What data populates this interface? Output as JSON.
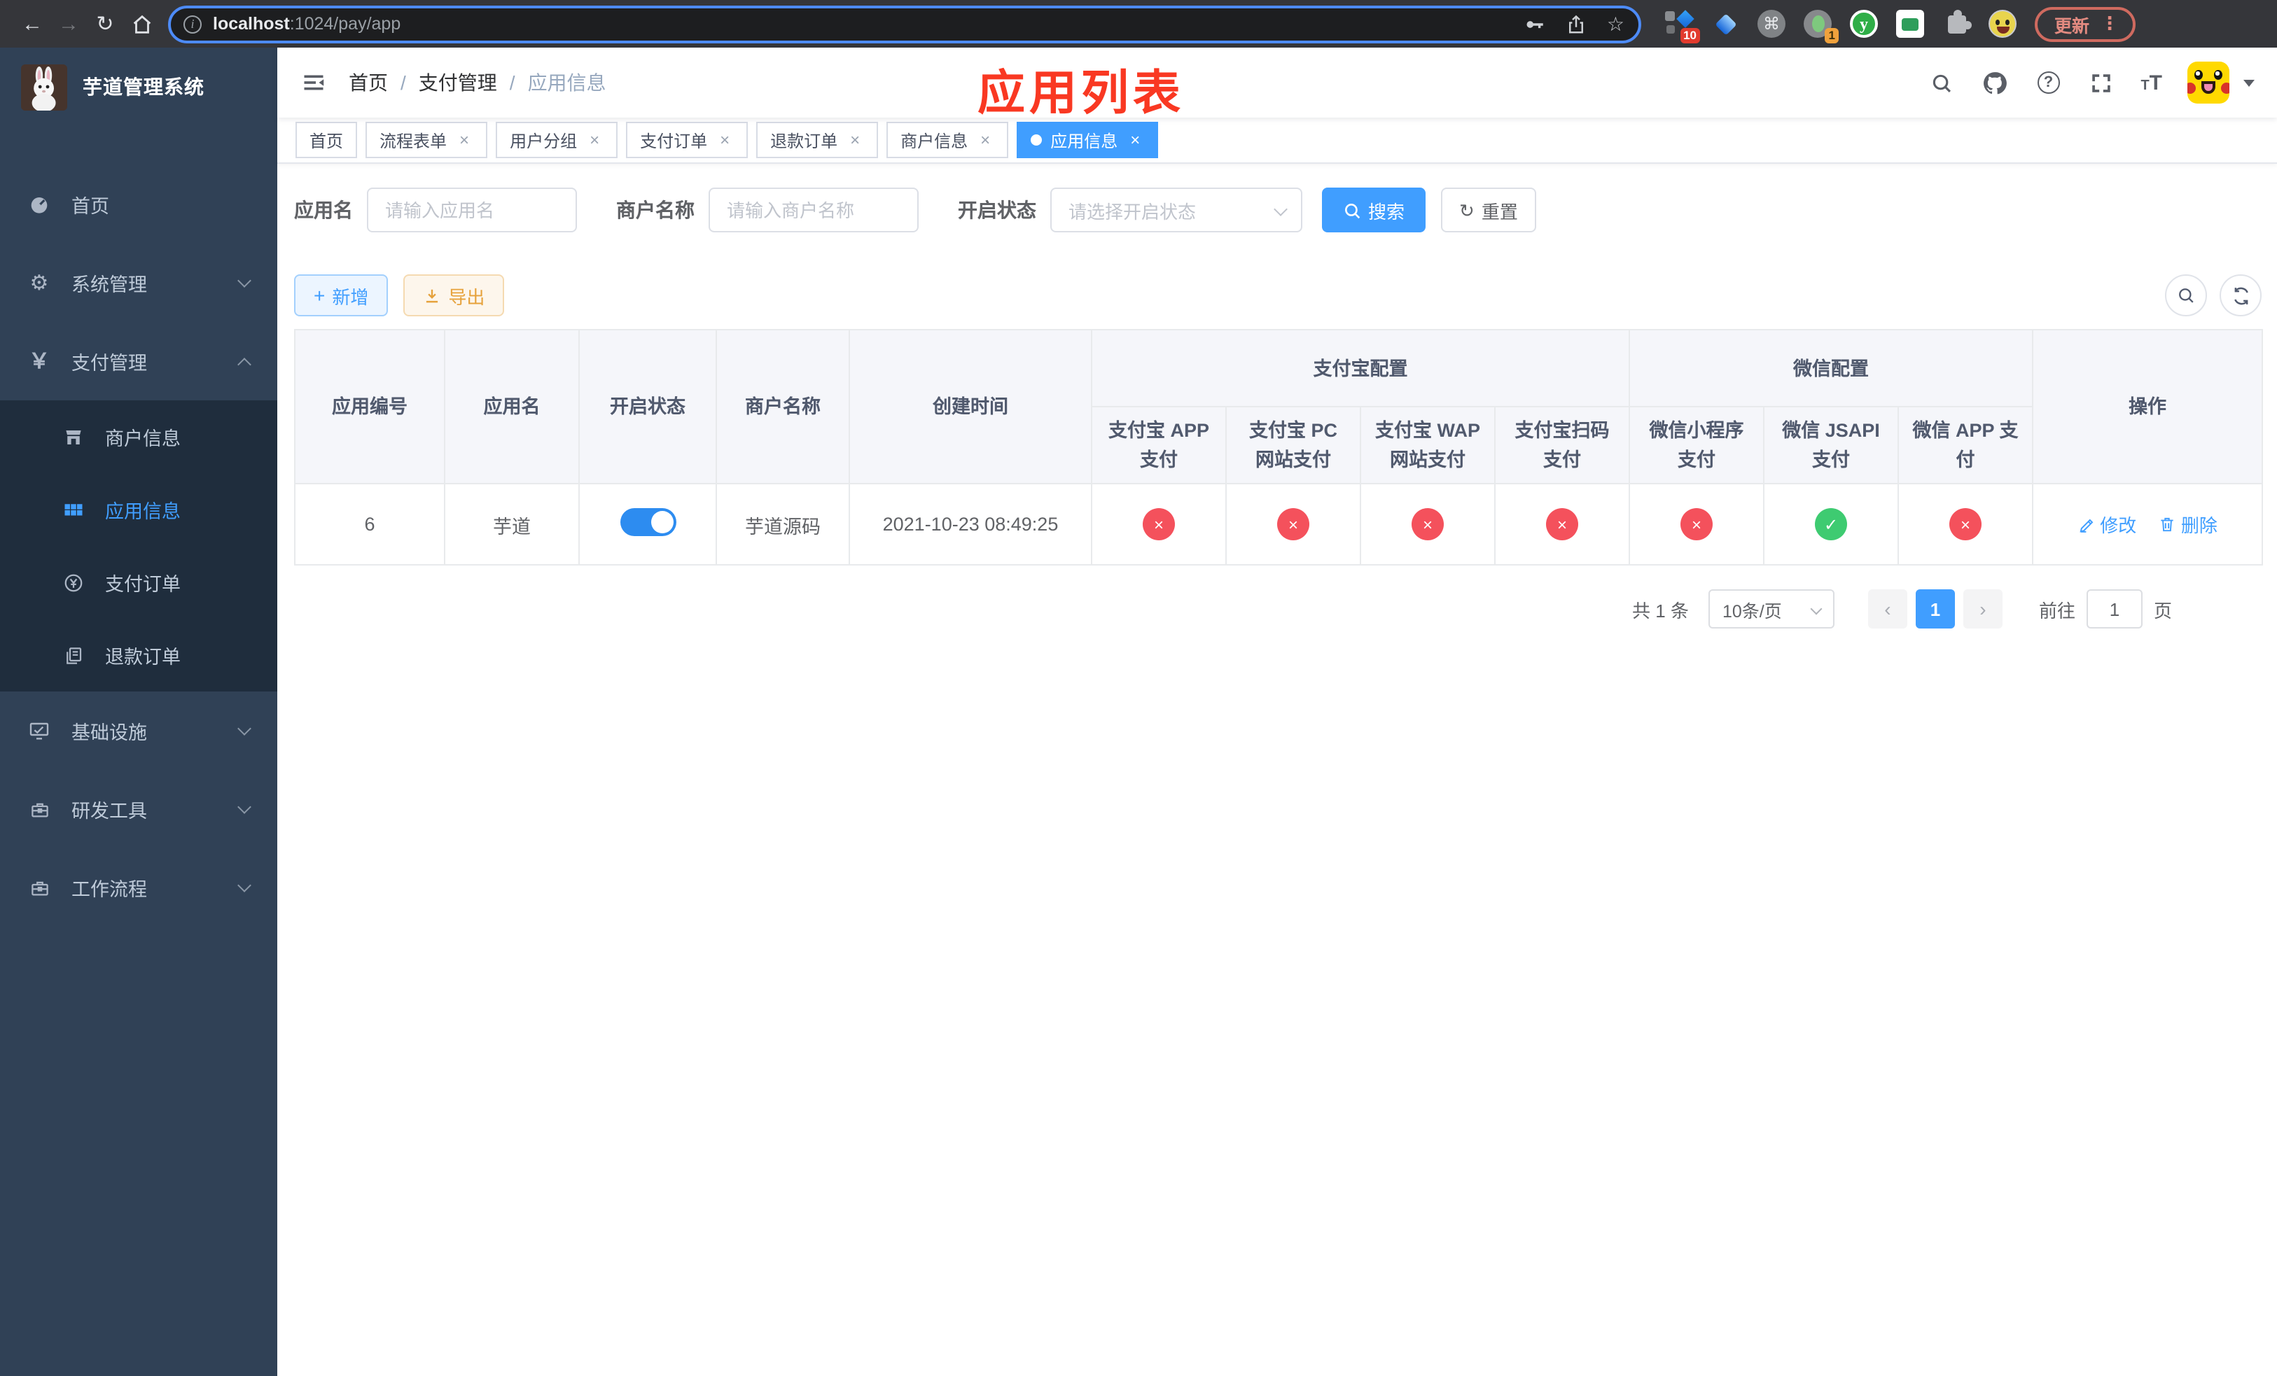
{
  "glyphs": {
    "back": "←",
    "forward": "→",
    "reload": "↻",
    "star": "☆",
    "info": "i",
    "cmd": "⌘",
    "y": "y",
    "dots": "⋮",
    "gear": "⚙",
    "yen": "￥",
    "help": "?",
    "t_small": "T",
    "t_large": "T",
    "plus": "+",
    "close": "×",
    "prev": "‹",
    "next": "›"
  },
  "browser": {
    "url": {
      "host": "localhost",
      "rest": ":1024/pay/app"
    },
    "ext_badge_blue": "10",
    "ext_badge_green": "1",
    "update_label": "更新"
  },
  "sidebar": {
    "title": "芋道管理系统",
    "items": [
      {
        "label": "首页"
      },
      {
        "label": "系统管理"
      },
      {
        "label": "支付管理"
      },
      {
        "label": "基础设施"
      },
      {
        "label": "研发工具"
      },
      {
        "label": "工作流程"
      }
    ],
    "payment_submenu": [
      {
        "label": "商户信息"
      },
      {
        "label": "应用信息",
        "active": true
      },
      {
        "label": "支付订单"
      },
      {
        "label": "退款订单"
      }
    ]
  },
  "header": {
    "breadcrumb": [
      "首页",
      "支付管理",
      "应用信息"
    ],
    "separator": "/",
    "annotation": "应用列表"
  },
  "tabs": [
    {
      "label": "首页",
      "closable": false
    },
    {
      "label": "流程表单",
      "closable": true
    },
    {
      "label": "用户分组",
      "closable": true
    },
    {
      "label": "支付订单",
      "closable": true
    },
    {
      "label": "退款订单",
      "closable": true
    },
    {
      "label": "商户信息",
      "closable": true
    },
    {
      "label": "应用信息",
      "closable": true,
      "active": true
    }
  ],
  "filters": {
    "name_label": "应用名",
    "name_placeholder": "请输入应用名",
    "merchant_label": "商户名称",
    "merchant_placeholder": "请输入商户名称",
    "status_label": "开启状态",
    "status_placeholder": "请选择开启状态",
    "search_label": "搜索",
    "reset_label": "重置"
  },
  "toolbar": {
    "add_label": "新增",
    "export_label": "导出"
  },
  "table": {
    "columns": [
      "应用编号",
      "应用名",
      "开启状态",
      "商户名称",
      "创建时间"
    ],
    "groups": {
      "alipay": "支付宝配置",
      "wechat": "微信配置"
    },
    "op_column": "操作",
    "sub_columns": [
      "支付宝 APP 支付",
      "支付宝 PC 网站支付",
      "支付宝 WAP 网站支付",
      "支付宝扫码支付",
      "微信小程序支付",
      "微信 JSAPI 支付",
      "微信 APP 支付"
    ],
    "row": {
      "id": "6",
      "name": "芋道",
      "enabled": "on",
      "merchant": "芋道源码",
      "created_at": "2021-10-23 08:49:25",
      "configs": [
        {
          "name": "alipay-app",
          "state": "off",
          "glyph": "×"
        },
        {
          "name": "alipay-pc",
          "state": "off",
          "glyph": "×"
        },
        {
          "name": "alipay-wap",
          "state": "off",
          "glyph": "×"
        },
        {
          "name": "alipay-qr",
          "state": "off",
          "glyph": "×"
        },
        {
          "name": "wechat-lite",
          "state": "off",
          "glyph": "×"
        },
        {
          "name": "wechat-jsapi",
          "state": "on",
          "glyph": "✓"
        },
        {
          "name": "wechat-app",
          "state": "off",
          "glyph": "×"
        }
      ],
      "edit_label": "修改",
      "delete_label": "删除"
    }
  },
  "pagination": {
    "total": "共 1 条",
    "page_size": "10条/页",
    "current_page": "1",
    "goto_label": "前往",
    "goto_value": "1",
    "unit_label": "页"
  },
  "colors": {
    "accent": "#409EFF",
    "success": "#3ECB71",
    "danger": "#F4515C",
    "sidebar_bg": "#304156",
    "submenu_bg": "#1F2D3D",
    "annotation_red": "#F93822",
    "export_orange": "#E6A23C"
  }
}
